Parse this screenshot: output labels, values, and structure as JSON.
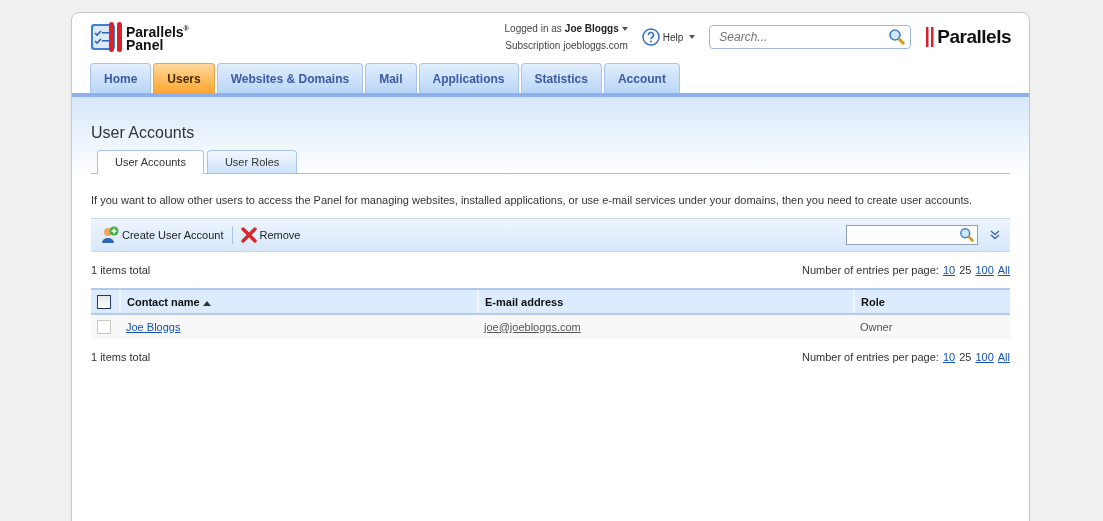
{
  "header": {
    "logo_line1": "Parallels",
    "logo_mark": "®",
    "logo_line2": "Panel",
    "logged_in_label": "Logged in as",
    "user": "Joe Bloggs",
    "subscription_label": "Subscription",
    "subscription": "joebloggs.com",
    "help": "Help",
    "search": {
      "placeholder": "Search..."
    },
    "brand": "Parallels"
  },
  "nav_tabs": [
    {
      "label": "Home",
      "selected": false
    },
    {
      "label": "Users",
      "selected": true
    },
    {
      "label": "Websites & Domains",
      "selected": false
    },
    {
      "label": "Mail",
      "selected": false
    },
    {
      "label": "Applications",
      "selected": false
    },
    {
      "label": "Statistics",
      "selected": false
    },
    {
      "label": "Account",
      "selected": false
    }
  ],
  "page_title": "User Accounts",
  "sub_tabs": [
    {
      "label": "User Accounts",
      "selected": true
    },
    {
      "label": "User Roles",
      "selected": false
    }
  ],
  "description": "If you want to allow other users to access the Panel for managing websites, installed applications, or use e-mail services under your domains, then you need to create user accounts.",
  "toolbar": {
    "buttons": [
      {
        "label": "Create User Account",
        "kind": "add-user"
      },
      {
        "label": "Remove",
        "kind": "remove"
      }
    ]
  },
  "total_top": "1 items total",
  "per_page_label_top": "Number of entries per page:",
  "per_page_top": [
    {
      "label": "10",
      "selected": false
    },
    {
      "label": "25",
      "selected": true
    },
    {
      "label": "100",
      "selected": false
    },
    {
      "label": "All",
      "selected": false
    }
  ],
  "table": {
    "select_all_checked": false,
    "columns": [
      "Contact name",
      "E-mail address",
      "Role"
    ],
    "rows": [
      {
        "checked": false,
        "name": "Joe Bloggs",
        "email": "joe@joebloggs.com",
        "role": "Owner"
      }
    ]
  },
  "total_bottom": "1 items total",
  "per_page_label_bottom": "Number of entries per page:",
  "per_page_bottom": [
    {
      "label": "10",
      "selected": false
    },
    {
      "label": "25",
      "selected": true
    },
    {
      "label": "100",
      "selected": false
    },
    {
      "label": "All",
      "selected": false
    }
  ]
}
